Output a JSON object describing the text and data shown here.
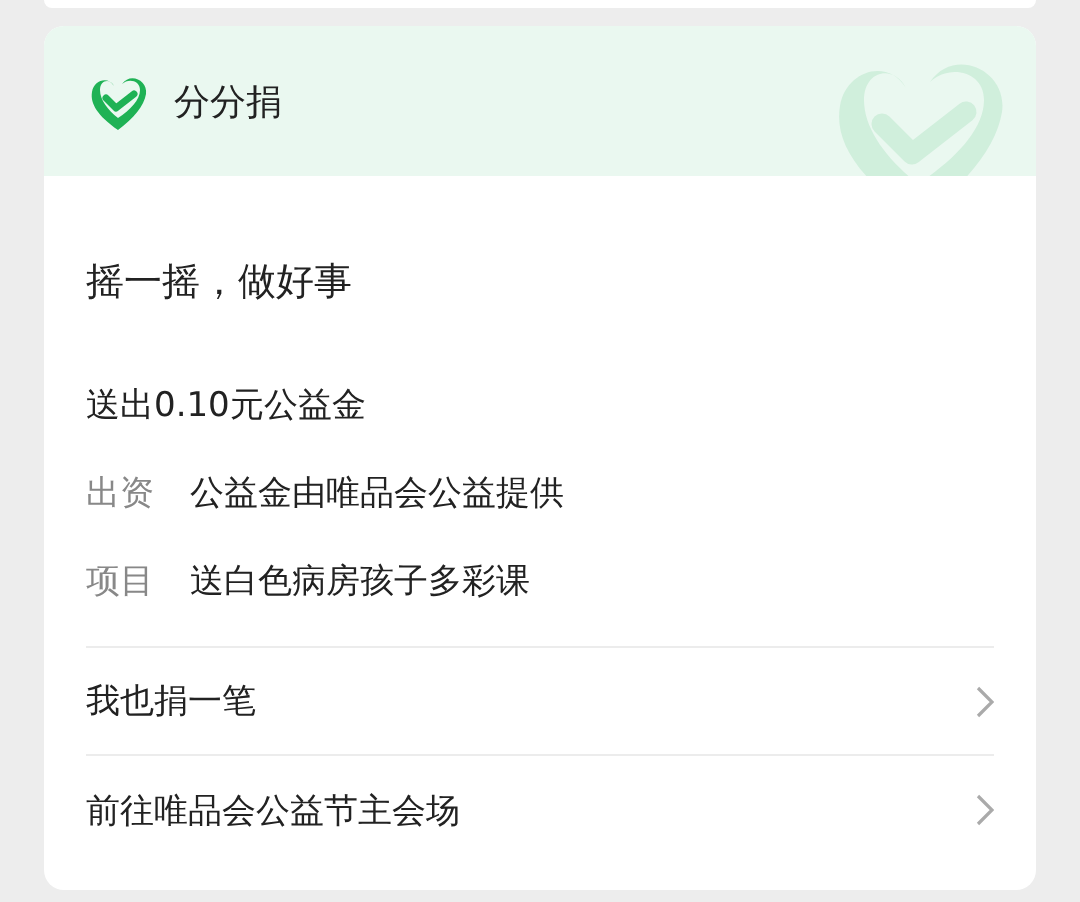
{
  "card": {
    "title": "分分捐",
    "headline": "摇一摇，做好事",
    "amount": "送出0.10元公益金",
    "details": [
      {
        "label": "出资",
        "value": "公益金由唯品会公益提供"
      },
      {
        "label": "项目",
        "value": "送白色病房孩子多彩课"
      }
    ],
    "links": [
      {
        "label": "我也捐一笔"
      },
      {
        "label": "前往唯品会公益节主会场"
      }
    ]
  }
}
